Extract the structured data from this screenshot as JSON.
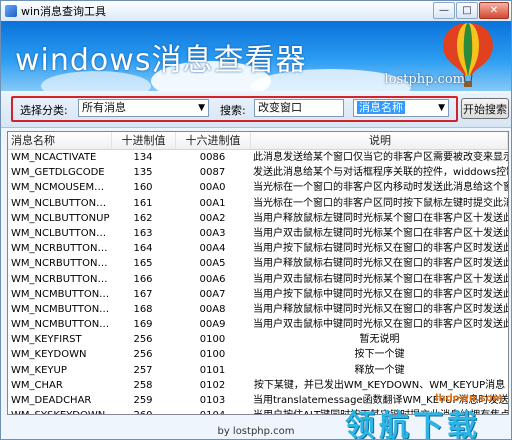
{
  "window": {
    "title": "win消息查询工具"
  },
  "banner": {
    "title": "windows消息查看器",
    "site": "lostphp.com"
  },
  "search": {
    "category_label": "选择分类:",
    "category_value": "所有消息",
    "search_label": "搜索:",
    "search_value": "改变窗口",
    "field_value": "消息名称",
    "button_label": "开始搜索"
  },
  "table": {
    "headers": [
      "消息名称",
      "十进制值",
      "十六进制值",
      "说明"
    ],
    "rows": [
      [
        "WM_NCACTIVATE",
        "134",
        "0086",
        "此消息发送给某个窗口仅当它的非客户区需要被改变来显示…"
      ],
      [
        "WM_GETDLGCODE",
        "135",
        "0087",
        "发送此消息给某个与对话框程序关联的控件，widdows控制…"
      ],
      [
        "WM_NCMOUSEM…",
        "160",
        "00A0",
        "当光标在一个窗口的非客户区内移动时发送此消息给这个窗…"
      ],
      [
        "WM_NCLBUTTON…",
        "161",
        "00A1",
        "当光标在一个窗口的非客户区同时按下鼠标左键时提交此消息"
      ],
      [
        "WM_NCLBUTTONUP",
        "162",
        "00A2",
        "当用户释放鼠标左键同时光标某个窗口在非客户区十发送此…"
      ],
      [
        "WM_NCLBUTTON…",
        "163",
        "00A3",
        "当用户双击鼠标左键同时光标某个窗口在非客户区十发送此…"
      ],
      [
        "WM_NCRBUTTON…",
        "164",
        "00A4",
        "当用户按下鼠标右键同时光标又在窗口的非客户区时发送此…"
      ],
      [
        "WM_NCRBUTTON…",
        "165",
        "00A5",
        "当用户释放鼠标右键同时光标又在窗口的非客户区时发送此…"
      ],
      [
        "WM_NCRBUTTON…",
        "166",
        "00A6",
        "当用户双击鼠标右键同时光标某个窗口在非客户区十发送此…"
      ],
      [
        "WM_NCMBUTTON…",
        "167",
        "00A7",
        "当用户按下鼠标中键同时光标又在窗口的非客户区时发送此…"
      ],
      [
        "WM_NCMBUTTON…",
        "168",
        "00A8",
        "当用户释放鼠标中键同时光标又在窗口的非客户区时发送此…"
      ],
      [
        "WM_NCMBUTTON…",
        "169",
        "00A9",
        "当用户双击鼠标中键同时光标又在窗口的非客户区时发送此…"
      ],
      [
        "WM_KEYFIRST",
        "256",
        "0100",
        "暂无说明"
      ],
      [
        "WM_KEYDOWN",
        "256",
        "0100",
        "按下一个键"
      ],
      [
        "WM_KEYUP",
        "257",
        "0101",
        "释放一个键"
      ],
      [
        "WM_CHAR",
        "258",
        "0102",
        "按下某键，并已发出WM_KEYDOWN、WM_KEYUP消息"
      ],
      [
        "WM_DEADCHAR",
        "259",
        "0103",
        "当用translatemessage函数翻译WM_KEYUP消息时发送此消…"
      ],
      [
        "WM_SYSKEYDOWN",
        "260",
        "0104",
        "当用户按住ALT键同时按下其它键时提交此消息给拥有焦点的…"
      ]
    ],
    "centered_desc_rows": [
      12,
      13,
      14,
      15
    ]
  },
  "footer": {
    "text": "by lostphp.com"
  },
  "watermark": {
    "big": "领航下载",
    "site": "lhdown.com"
  },
  "colors": {
    "banner": "#1a86e6",
    "highlight": "#d2232a",
    "selection": "#3399ff"
  }
}
